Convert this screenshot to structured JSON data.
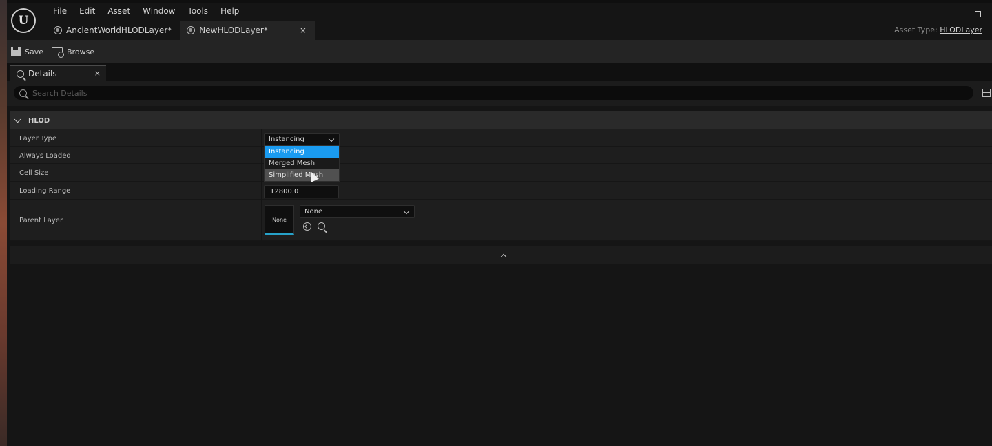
{
  "app": {
    "logo_letter": "U"
  },
  "menu": [
    "File",
    "Edit",
    "Asset",
    "Window",
    "Tools",
    "Help"
  ],
  "window_controls": {
    "minimize": "–"
  },
  "doc_tabs": [
    {
      "label": "AncientWorldHLODLayer*",
      "active": false
    },
    {
      "label": "NewHLODLayer*",
      "active": true,
      "close": "×"
    }
  ],
  "asset_type": {
    "label": "Asset Type:",
    "value": "HLODLayer"
  },
  "toolbar": {
    "save_label": "Save",
    "browse_label": "Browse"
  },
  "panel": {
    "tab_label": "Details",
    "close": "×"
  },
  "search": {
    "placeholder": "Search Details",
    "value": ""
  },
  "category": {
    "label": "HLOD"
  },
  "properties": [
    {
      "label": "Layer Type"
    },
    {
      "label": "Always Loaded"
    },
    {
      "label": "Cell Size"
    },
    {
      "label": "Loading Range"
    },
    {
      "label": "Parent Layer"
    }
  ],
  "layer_type": {
    "selected": "Instancing",
    "options": [
      "Instancing",
      "Merged Mesh",
      "Simplified Mesh"
    ],
    "hovered": "Simplified Mesh"
  },
  "loading_range": {
    "value": "12800.0"
  },
  "parent_layer": {
    "thumb_label": "None",
    "value": "None"
  },
  "colors": {
    "accent": "#1a9bf0",
    "thumb_underline": "#27a2c9",
    "hover": "#505050"
  },
  "icons": [
    "save-icon",
    "browse-icon",
    "details-icon",
    "search-icon",
    "grid-icon",
    "reset-icon",
    "find-icon"
  ]
}
